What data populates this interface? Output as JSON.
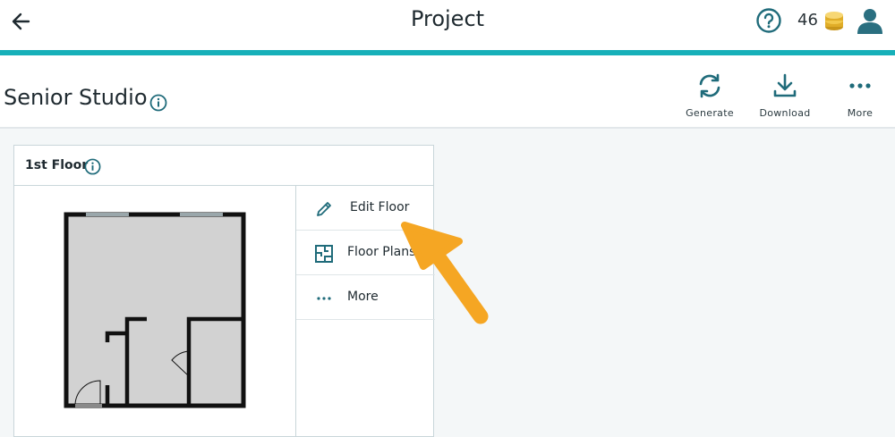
{
  "app": {
    "title": "Project",
    "coins": "46",
    "accent_color": "#17b0b9",
    "icons": {
      "back": "arrow-left-icon",
      "help": "question-circle-icon",
      "coins": "coin-stack-icon",
      "user": "user-icon"
    }
  },
  "project": {
    "name": "Senior Studio",
    "actions": [
      {
        "label": "Generate",
        "icon": "refresh-icon"
      },
      {
        "label": "Download",
        "icon": "download-icon"
      },
      {
        "label": "More",
        "icon": "more-horizontal-icon"
      }
    ]
  },
  "floor": {
    "title": "1st Floor",
    "menu": [
      {
        "label": "Edit Floor",
        "icon": "pencil-icon"
      },
      {
        "label": "Floor Plans",
        "icon": "floor-plan-icon"
      },
      {
        "label": "More",
        "icon": "more-horizontal-icon"
      }
    ],
    "pointer_color": "#f5a623"
  }
}
